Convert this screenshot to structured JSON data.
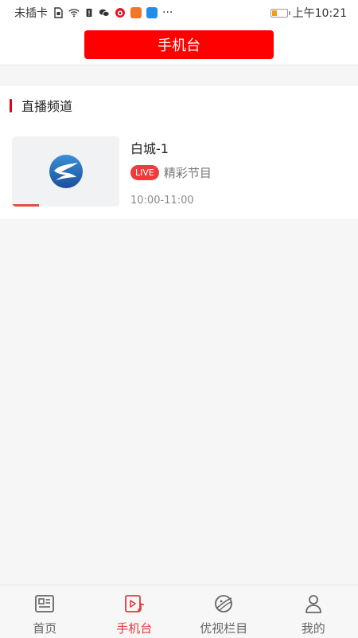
{
  "status_bar": {
    "carrier": "未插卡",
    "time": "上午10:21",
    "more": "···"
  },
  "header": {
    "title": "手机台"
  },
  "section": {
    "title": "直播频道"
  },
  "channels": [
    {
      "name": "白城-1",
      "badge": "LIVE",
      "program": "精彩节目",
      "time": "10:00-11:00"
    }
  ],
  "bottom_nav": {
    "items": [
      {
        "label": "首页",
        "icon": "news-icon",
        "active": false
      },
      {
        "label": "手机台",
        "icon": "video-music-icon",
        "active": true
      },
      {
        "label": "优视栏目",
        "icon": "planet-icon",
        "active": false
      },
      {
        "label": "我的",
        "icon": "user-icon",
        "active": false
      }
    ]
  },
  "colors": {
    "accent": "#ff0000",
    "active_nav": "#e4393c",
    "live_badge": "#ee3b3b"
  }
}
